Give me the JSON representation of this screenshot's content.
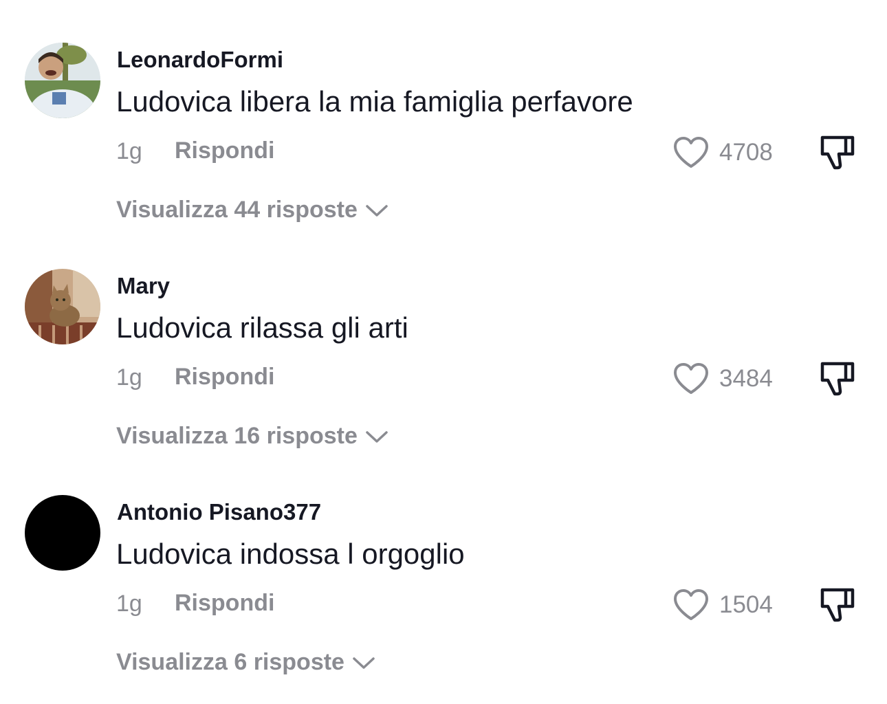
{
  "comments": [
    {
      "username": "LeonardoFormi",
      "text": "Ludovica libera la mia famiglia perfavore",
      "time": "1g",
      "reply_label": "Rispondi",
      "likes": "4708",
      "view_replies": "Visualizza 44 risposte",
      "avatar": "photo-person"
    },
    {
      "username": "Mary",
      "text": "Ludovica rilassa gli arti",
      "time": "1g",
      "reply_label": "Rispondi",
      "likes": "3484",
      "view_replies": "Visualizza 16 risposte",
      "avatar": "photo-cat"
    },
    {
      "username": "Antonio Pisano377",
      "text": "Ludovica indossa l orgoglio",
      "time": "1g",
      "reply_label": "Rispondi",
      "likes": "1504",
      "view_replies": "Visualizza 6 risposte",
      "avatar": "black-circle"
    }
  ],
  "icons": {
    "like": "heart-outline-icon",
    "dislike": "thumbs-down-icon",
    "expand": "chevron-down-icon"
  },
  "colors": {
    "text_primary": "#161823",
    "text_secondary": "#8a8b91",
    "background": "#ffffff"
  }
}
